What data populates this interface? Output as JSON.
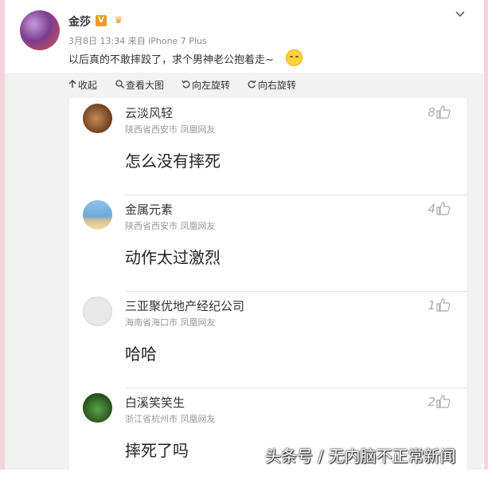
{
  "post": {
    "username": "金莎",
    "vip_badge": "V",
    "meta": "3月8日 13:34 来自 iPhone 7 Plus",
    "text": "以后真的不敢摔跤了，求个男神老公抱着走~"
  },
  "toolbar": {
    "collapse": "收起",
    "view_large": "查看大图",
    "rotate_left": "向左旋转",
    "rotate_right": "向右旋转"
  },
  "comments": [
    {
      "name": "云淡风轻",
      "location": "陕西省西安市 凤凰网友",
      "text": "怎么没有摔死",
      "likes": "8"
    },
    {
      "name": "金属元素",
      "location": "陕西省西安市 凤凰网友",
      "text": "动作太过激烈",
      "likes": "4"
    },
    {
      "name": "三亚聚优地产经纪公司",
      "location": "海南省海口市 凤凰网友",
      "text": "哈哈",
      "likes": "1"
    },
    {
      "name": "白溪笑笑生",
      "location": "浙江省杭州市 凤凰网友",
      "text": "摔死了吗",
      "likes": "2"
    }
  ],
  "watermark": "头条号 / 无内脑不正常新闻",
  "colors": {
    "badge": "#f29a1b",
    "panel": "#f2f2f2",
    "side": "#f6d3dc"
  },
  "icons": [
    "collapse-icon",
    "search-icon",
    "rotate-left-icon",
    "rotate-right-icon",
    "thumb-up-icon",
    "chevron-down-icon"
  ]
}
